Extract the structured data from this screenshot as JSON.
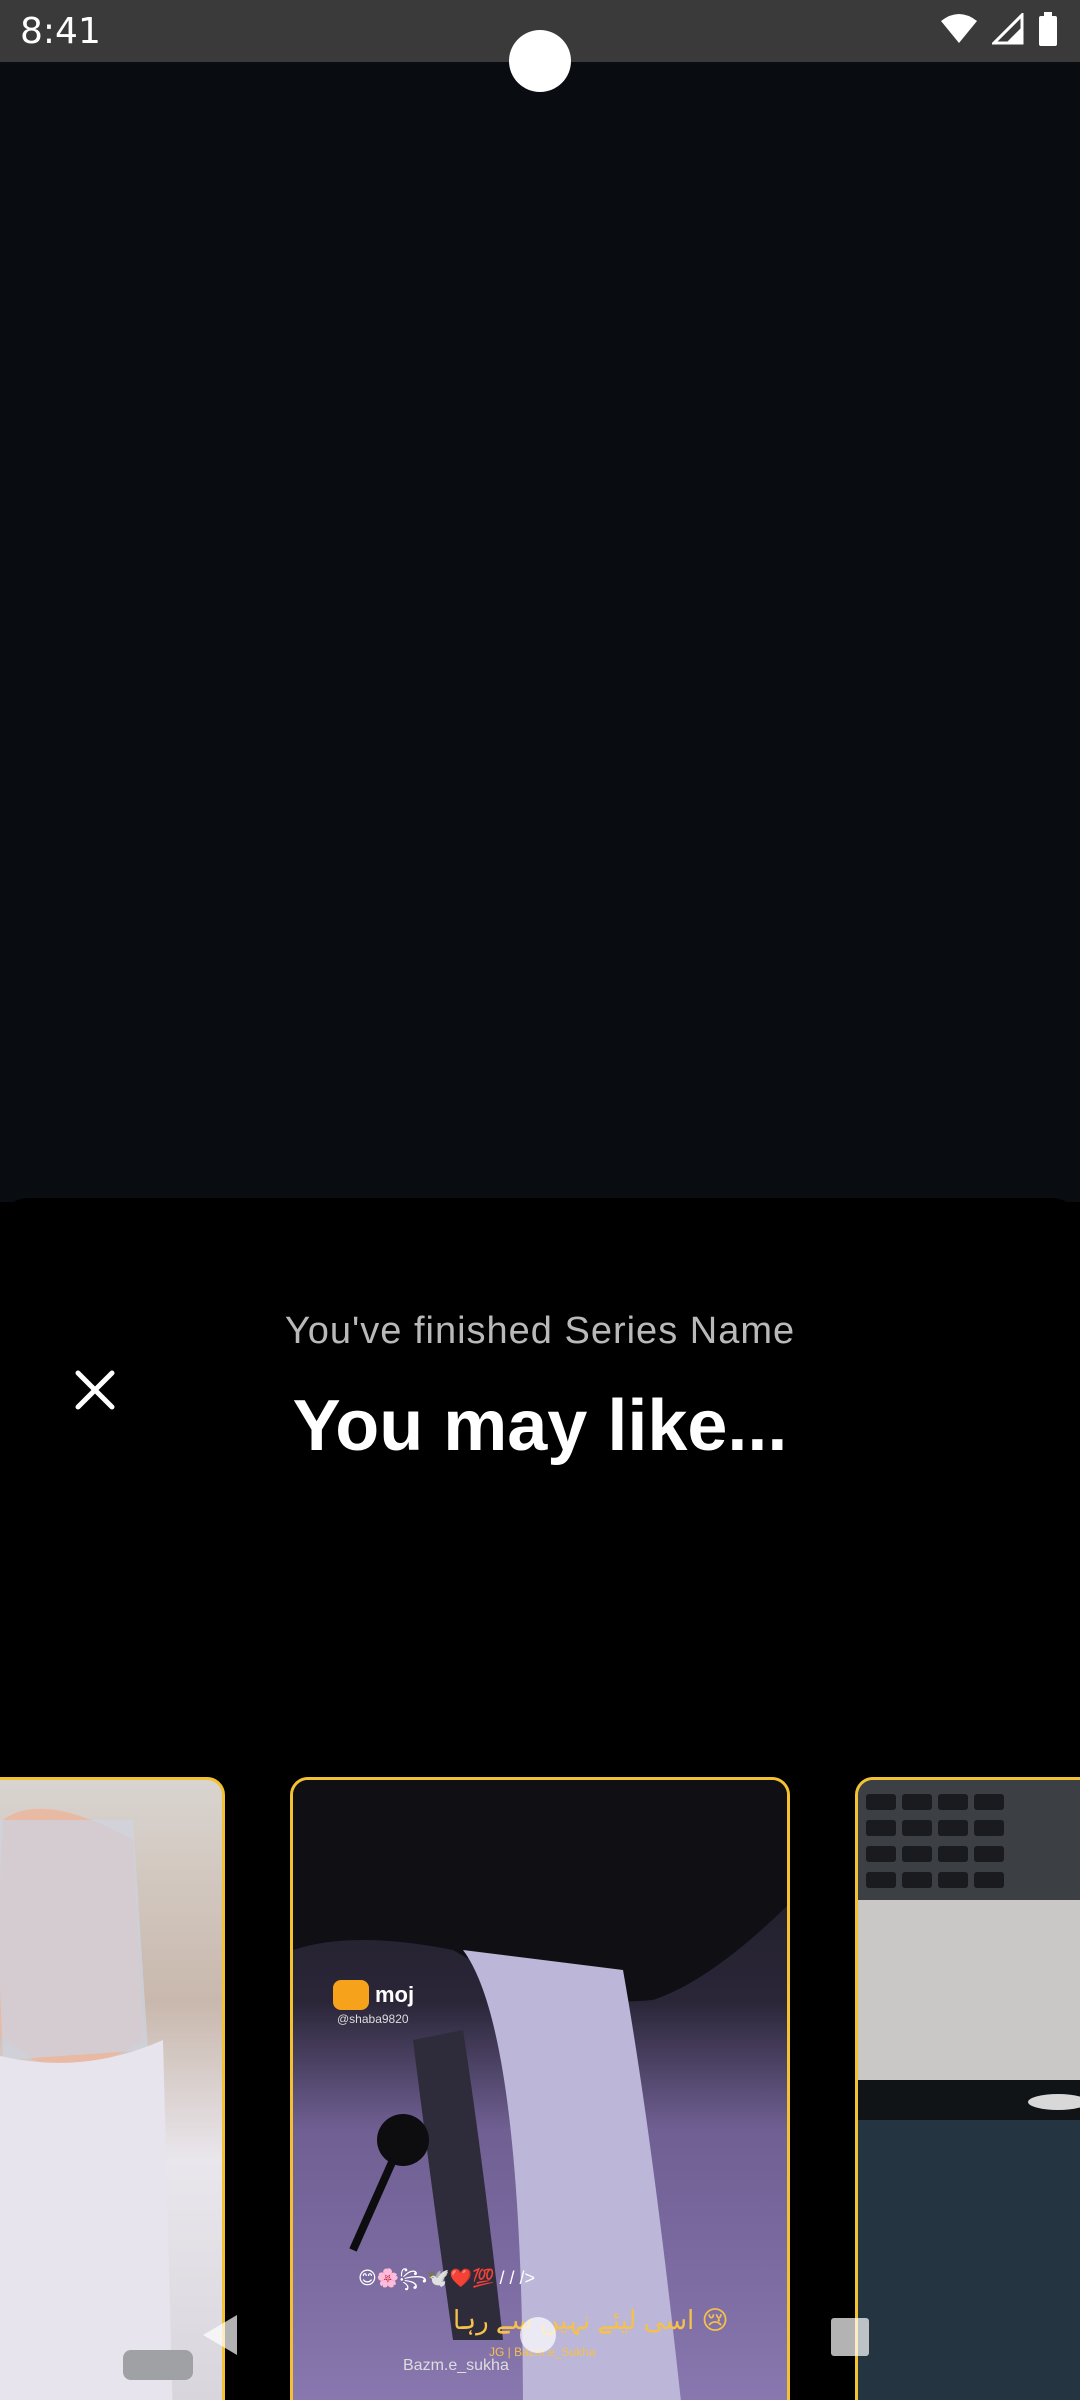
{
  "status_bar": {
    "time": "8:41",
    "icons": [
      "wifi-icon",
      "signal-icon",
      "battery-icon"
    ]
  },
  "end_sheet": {
    "subtitle": "You've finished Series Name",
    "title": "You may like...",
    "close_icon": "close-icon"
  },
  "cards": [
    {
      "position": "left"
    },
    {
      "position": "center",
      "moj_brand": "moj",
      "moj_handle": "@shaba9820",
      "caption_emoji": "😊🌸꧂🕊️❤️💯 / / />",
      "caption_urdu": "اسی لیئے نہیں سے رہا 😢",
      "caption_small": "JG | Bazm.e_Sukha",
      "caption_handle": "Bazm.e_sukha"
    },
    {
      "position": "right"
    }
  ],
  "colors": {
    "accent": "#f2c230",
    "background": "#000000",
    "player": "#090c10",
    "status_bar": "#3a3a3a"
  },
  "nav": {
    "back": "back-icon",
    "home": "home-icon",
    "recent": "recents-icon"
  }
}
